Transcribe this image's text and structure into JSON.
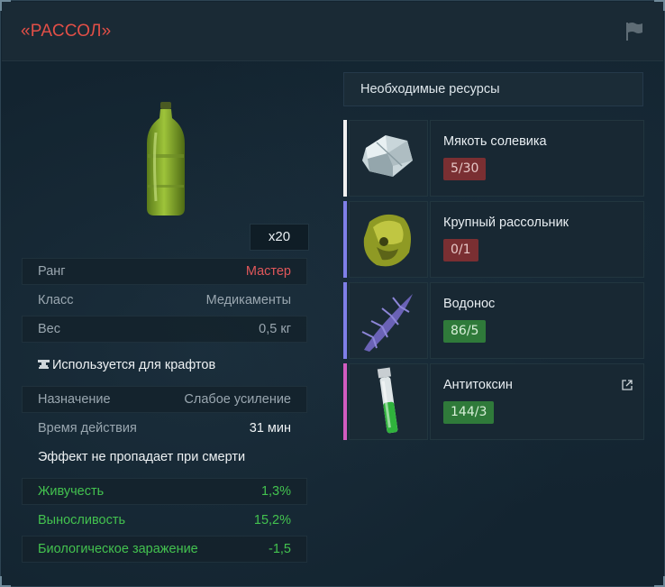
{
  "title": "«РАССОЛ»",
  "quantity": "x20",
  "stats": {
    "rank_label": "Ранг",
    "rank_value": "Мастер",
    "class_label": "Класс",
    "class_value": "Медикаменты",
    "weight_label": "Вес",
    "weight_value": "0,5 кг",
    "crafting_note": "Используется для крафтов",
    "purpose_label": "Назначение",
    "purpose_value": "Слабое усиление",
    "duration_label": "Время действия",
    "duration_value": "31 мин",
    "death_note": "Эффект не пропадает при смерти"
  },
  "effects": [
    {
      "label": "Живучесть",
      "value": "1,3%"
    },
    {
      "label": "Выносливость",
      "value": "15,2%"
    },
    {
      "label": "Биологическое заражение",
      "value": "-1,5"
    }
  ],
  "resources_header": "Необходимые ресурсы",
  "resources": [
    {
      "name": "Мякоть солевика",
      "count": "5/30",
      "status": "insufficient",
      "bar_color": "#f1f1f1",
      "icon": "salt-crystal-icon"
    },
    {
      "name": "Крупный рассольник",
      "count": "0/1",
      "status": "insufficient",
      "bar_color": "#7f7fe8",
      "icon": "green-ore-icon"
    },
    {
      "name": "Водонос",
      "count": "86/5",
      "status": "sufficient",
      "bar_color": "#7f7fe8",
      "icon": "purple-spike-icon"
    },
    {
      "name": "Антитоксин",
      "count": "144/3",
      "status": "sufficient",
      "bar_color": "#d25cc0",
      "icon": "antitoxin-vial-icon"
    }
  ],
  "colors": {
    "title": "#e24f47",
    "rank_master": "#e0575a",
    "effect_green": "#43c24f",
    "badge_bad": "#7a2f32",
    "badge_good": "#2f7a3a"
  }
}
